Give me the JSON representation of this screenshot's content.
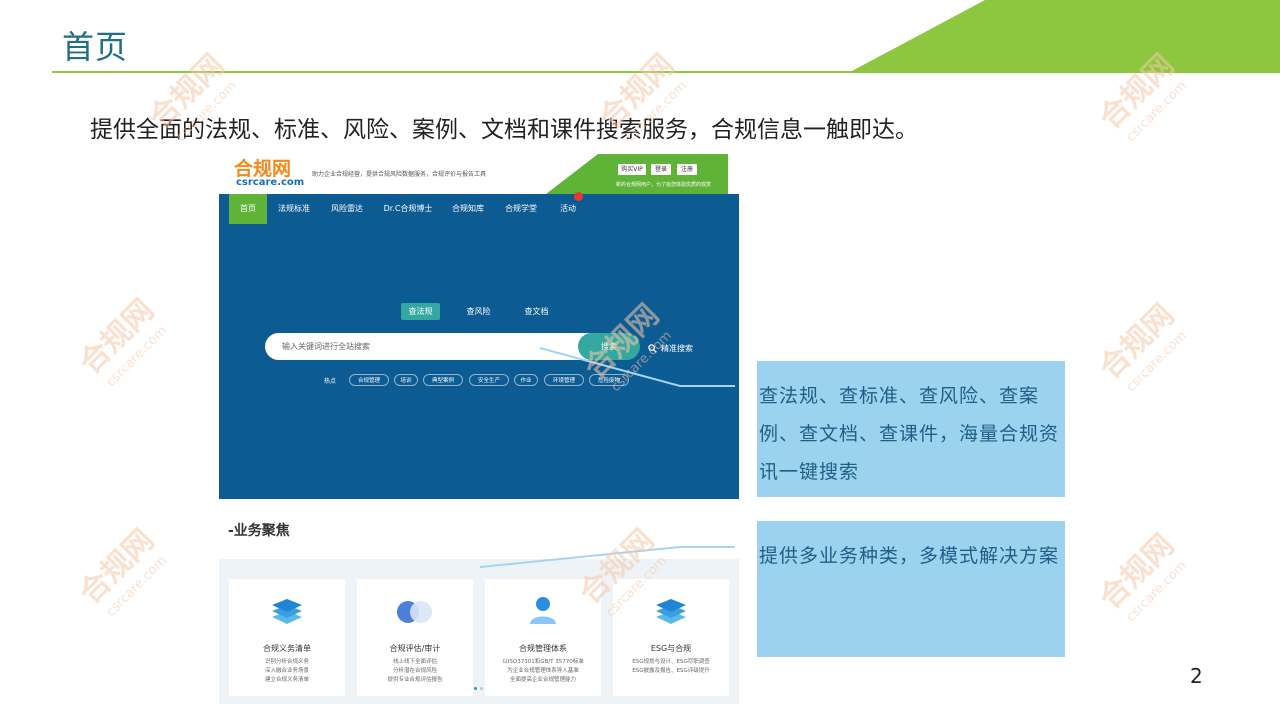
{
  "slide": {
    "title": "首页",
    "subtitle": "提供全面的法规、标准、风险、案例、文档和课件搜索服务，合规信息一触即达。",
    "page_number": "2",
    "accent_color": "#8dc63f",
    "title_color": "#1f6f8b"
  },
  "watermark": {
    "cn": "合规网",
    "en": "csrcare.com"
  },
  "site": {
    "logo_cn": "合规网",
    "logo_en": "csrcare.com",
    "tagline": "助力企业合规经营，提供合规风险数据服务，合规评价与报告工具",
    "top_buttons": [
      "购买VIP",
      "登录",
      "注册"
    ],
    "top_note": "新的合规网用户，为了给您体验优质的观赏",
    "nav": [
      "首页",
      "法规标准",
      "风险雷达",
      "Dr.C合规博士",
      "合规知库",
      "合规学堂",
      "活动"
    ],
    "hot_badge": "HOT",
    "search_tabs": [
      "查法规",
      "查风险",
      "查文档"
    ],
    "search_placeholder": "输入关键词进行全站搜索",
    "search_button": "搜索",
    "advanced_search": "精准搜索",
    "hot_label": "热点",
    "hot_tags": [
      "合规管理",
      "培训",
      "典型案例",
      "安全生产",
      "作业",
      "环境管理",
      "危险废物"
    ],
    "business_title": "-业务聚焦",
    "cards": [
      {
        "title": "合规义务清单",
        "desc": [
          "识别分析合规义务",
          "深入融合业务场景",
          "建立合规义务清单"
        ]
      },
      {
        "title": "合规评估/审计",
        "desc": [
          "线上线下全面评估",
          "分析潜在合规风险",
          "提供专业合规评估报告"
        ]
      },
      {
        "title": "合规管理体系",
        "desc": [
          "以ISO37301和GB/T 35770标准",
          "为企业合规管理体系导入基准",
          "全面提高企业合规管理能力"
        ]
      },
      {
        "title": "ESG与合规",
        "desc": [
          "ESG规划与设计、ESG尽职调查",
          "ESG披露及报告、ESG评级提升"
        ]
      }
    ]
  },
  "callouts": [
    {
      "text": "查法规、查标准、查风险、查案例、查文档、查课件，海量合规资讯一键搜索"
    },
    {
      "text": "提供多业务种类，多模式解决方案"
    }
  ]
}
